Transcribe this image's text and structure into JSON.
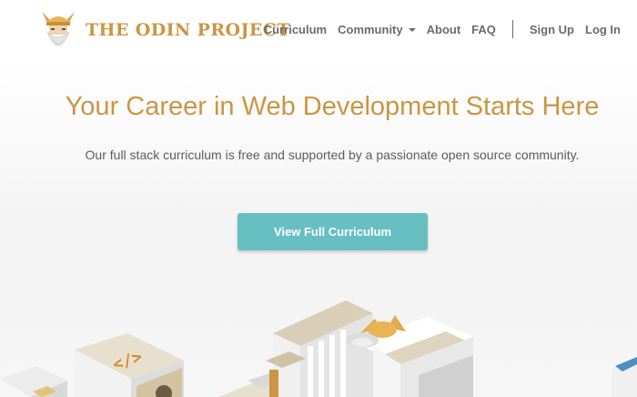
{
  "brand": {
    "name": "THE ODIN PROJECT"
  },
  "nav": {
    "items": [
      {
        "label": "Curriculum"
      },
      {
        "label": "Community"
      },
      {
        "label": "About"
      },
      {
        "label": "FAQ"
      }
    ],
    "auth": [
      {
        "label": "Sign Up"
      },
      {
        "label": "Log In"
      }
    ]
  },
  "hero": {
    "title": "Your Career in Web Development Starts Here",
    "subtitle": "Our full stack curriculum is free and supported by a passionate open source community.",
    "cta_label": "View Full Curriculum",
    "code_block_glyph": "</>"
  },
  "colors": {
    "brand_gold": "#cc9543",
    "cta_teal": "#67bfc2",
    "nav_text": "#6b6b6b",
    "body_text": "#5d5d5d"
  },
  "icons": {
    "logo": "odin-viking-head-icon",
    "dropdown": "caret-down-icon"
  }
}
